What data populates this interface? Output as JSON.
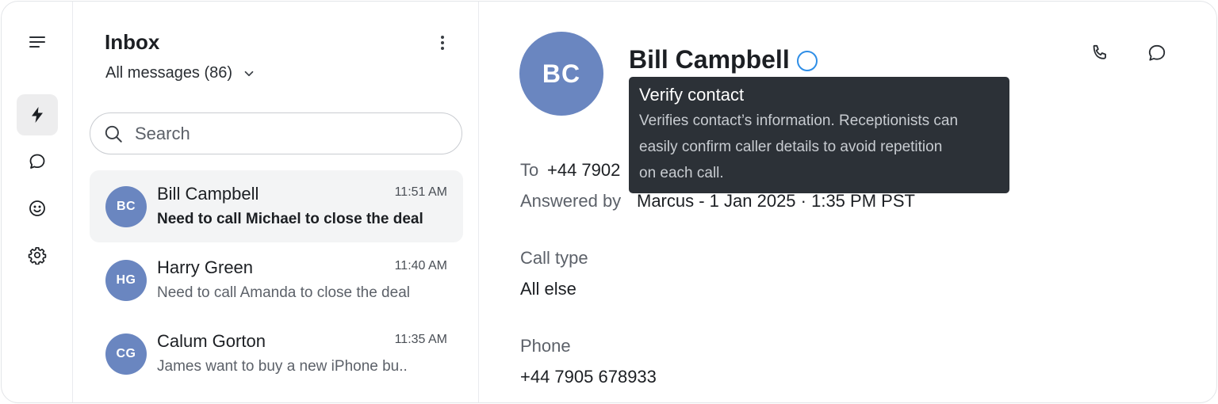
{
  "inbox": {
    "title": "Inbox",
    "filter_label": "All messages (86)",
    "search_placeholder": "Search",
    "conversations": [
      {
        "initials": "BC",
        "name": "Bill Campbell",
        "time": "11:51 AM",
        "preview": "Need to call Michael to close the deal",
        "selected": true
      },
      {
        "initials": "HG",
        "name": "Harry Green",
        "time": "11:40 AM",
        "preview": "Need to call Amanda to close the deal",
        "selected": false
      },
      {
        "initials": "CG",
        "name": "Calum Gorton",
        "time": "11:35 AM",
        "preview": "James want to buy a new iPhone bu..",
        "selected": false
      }
    ]
  },
  "detail": {
    "initials": "BC",
    "name": "Bill Campbell",
    "to_label": "To",
    "to_value": "+44 7902",
    "answered_label": "Answered by",
    "answered_value": "Marcus - 1 Jan 2025 · 1:35 PM PST",
    "call_type_label": "Call type",
    "call_type_value": "All else",
    "phone_label": "Phone",
    "phone_value": "+44 7905 678933"
  },
  "tooltip": {
    "title": "Verify contact",
    "line1": "Verifies contact’s information. Receptionists can",
    "line2": "easily confirm caller details to avoid repetition",
    "line3": "on each call."
  },
  "icons": {
    "rail": [
      "menu-icon",
      "lightning-icon",
      "chat-bubble-icon",
      "smiley-icon",
      "gear-icon"
    ],
    "actions": [
      "phone-icon",
      "message-icon"
    ]
  },
  "colors": {
    "avatar": "#6a86c0",
    "verify_ring": "#2f8ee6",
    "tooltip_bg": "#2c3137",
    "active_rail": "#ededee"
  }
}
